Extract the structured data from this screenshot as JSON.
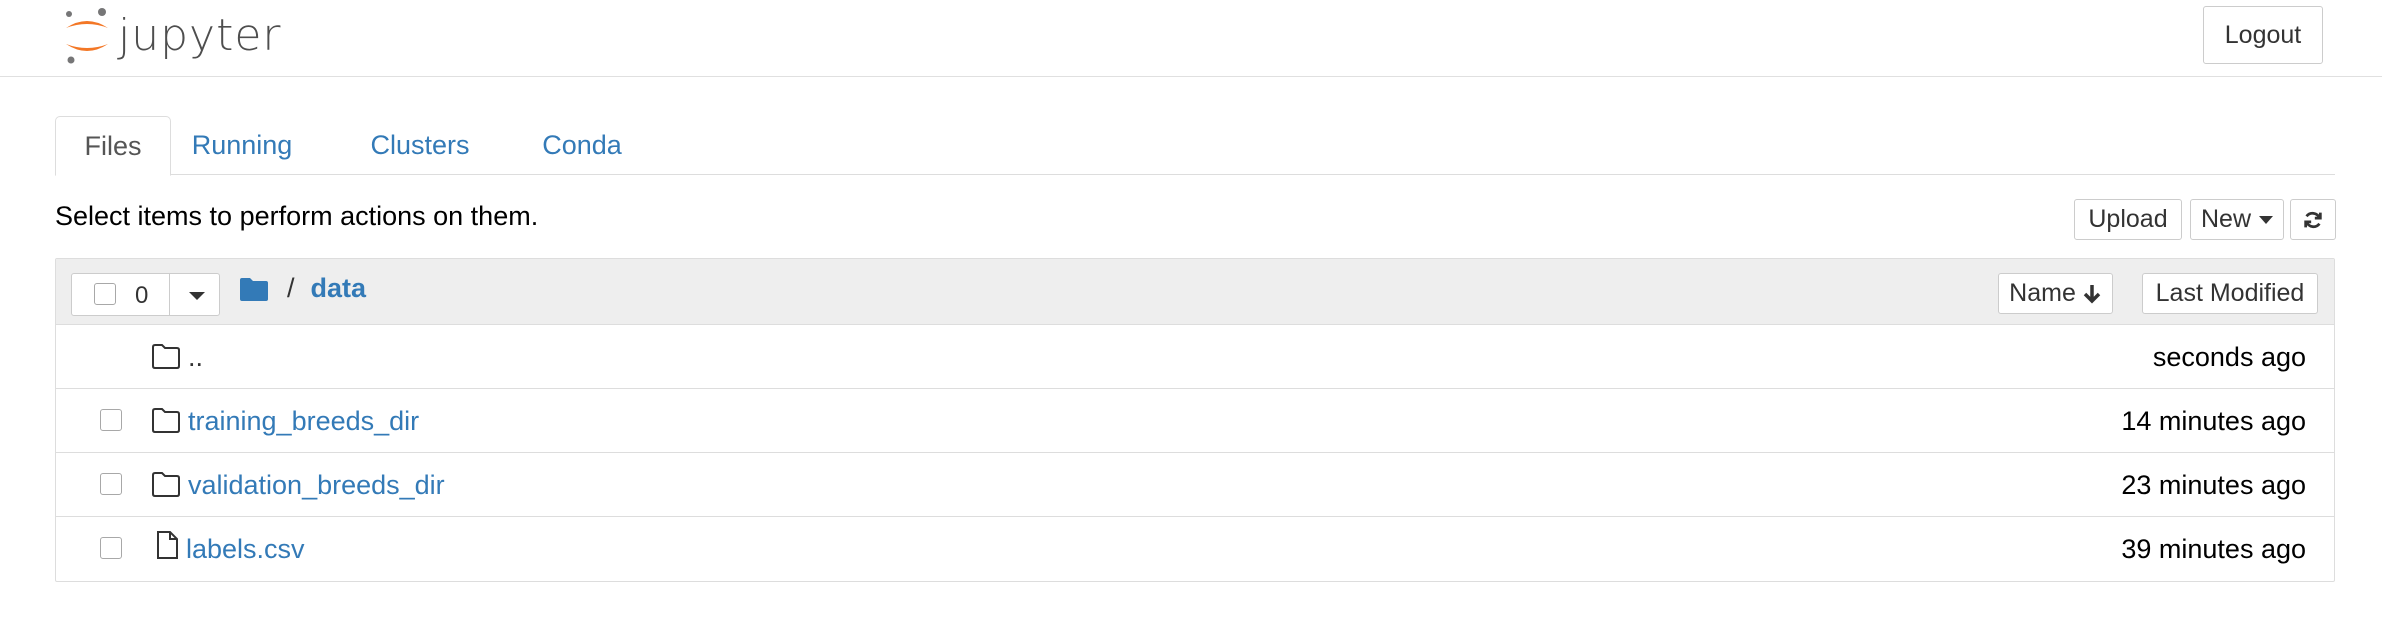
{
  "header": {
    "logo_text": "jupyter",
    "logout_label": "Logout"
  },
  "tabs": [
    {
      "label": "Files"
    },
    {
      "label": "Running"
    },
    {
      "label": "Clusters"
    },
    {
      "label": "Conda"
    }
  ],
  "toolbar": {
    "hint": "Select items to perform actions on them.",
    "upload_label": "Upload",
    "new_label": "New"
  },
  "list_header": {
    "selected_count": "0",
    "breadcrumb_sep": "/",
    "current_dir": "data",
    "sort_name_label": "Name",
    "sort_modified_label": "Last Modified"
  },
  "rows": [
    {
      "name": "..",
      "type": "folder",
      "modified": "seconds ago"
    },
    {
      "name": "training_breeds_dir",
      "type": "folder",
      "modified": "14 minutes ago"
    },
    {
      "name": "validation_breeds_dir",
      "type": "folder",
      "modified": "23 minutes ago"
    },
    {
      "name": "labels.csv",
      "type": "file",
      "modified": "39 minutes ago"
    }
  ],
  "colors": {
    "accent": "#337ab7",
    "logo_orange": "#f37726"
  }
}
